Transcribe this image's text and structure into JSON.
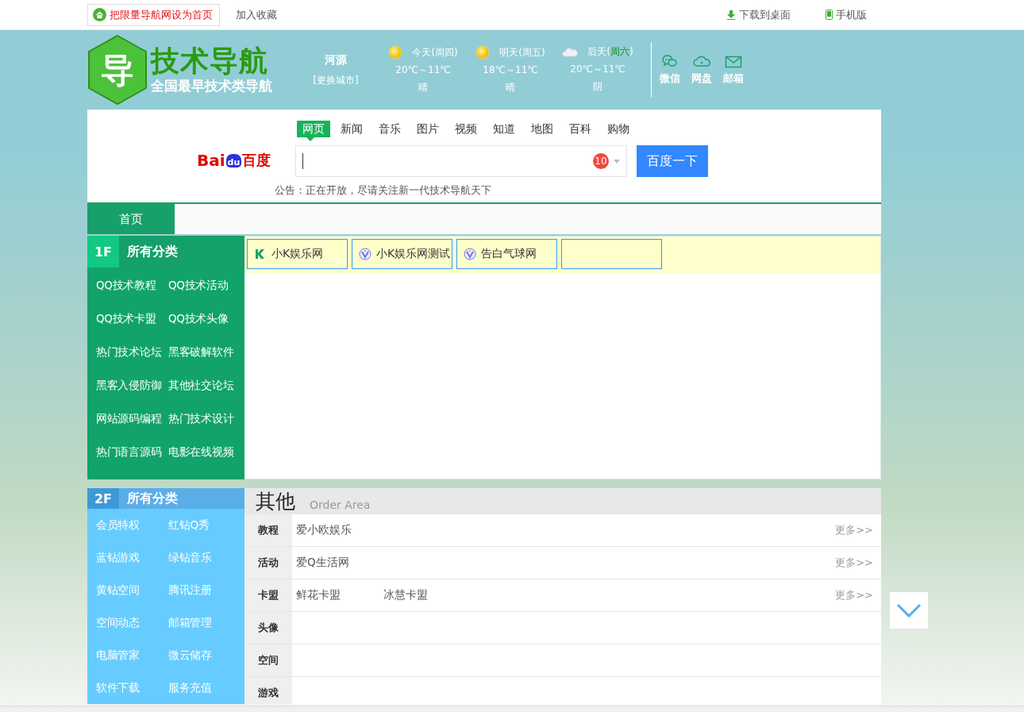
{
  "top_bar": {
    "set_homepage": "把限量导航网设为首页",
    "add_favorite": "加入收藏",
    "download": "下载到桌面",
    "mobile": "手机版"
  },
  "header": {
    "logo_glyph": "导",
    "logo_title": "技术导航",
    "logo_slogan": "全国最早技术类导航",
    "city": "河源",
    "change_city": "[更换城市]",
    "forecast": [
      {
        "kind": "sunny",
        "before": "今天(",
        "weekday": "周四",
        "after": ")",
        "weekday_highlight": false,
        "temperature": "20℃～11℃",
        "condition": "晴"
      },
      {
        "kind": "sunny",
        "before": "明天(",
        "weekday": "周五",
        "after": ")",
        "weekday_highlight": false,
        "temperature": "18℃～11℃",
        "condition": "晴"
      },
      {
        "kind": "cloudy",
        "before": "后天(",
        "weekday": "周六",
        "after": ")",
        "weekday_highlight": true,
        "temperature": "20℃～11℃",
        "condition": "阴"
      }
    ],
    "quick_links": [
      {
        "kind": "chat",
        "label": "微信"
      },
      {
        "kind": "cloud",
        "label": "网盘"
      },
      {
        "kind": "mail",
        "label": "邮箱"
      }
    ]
  },
  "search": {
    "logo_left": "Bai",
    "logo_paw": "du",
    "logo_right": "百度",
    "tabs": [
      {
        "label": "网页",
        "selected": true
      },
      {
        "label": "新闻",
        "selected": false
      },
      {
        "label": "音乐",
        "selected": false
      },
      {
        "label": "图片",
        "selected": false
      },
      {
        "label": "视频",
        "selected": false
      },
      {
        "label": "知道",
        "selected": false
      },
      {
        "label": "地图",
        "selected": false
      },
      {
        "label": "百科",
        "selected": false
      },
      {
        "label": "购物",
        "selected": false
      }
    ],
    "badge": "10",
    "button": "百度一下",
    "notice": "公告：正在开放，尽请关注新一代技术导航天下"
  },
  "nav": [
    {
      "label": "首页",
      "selected": true
    }
  ],
  "floor1": {
    "number": "1F",
    "title": "所有分类",
    "categories": [
      "QQ技术教程",
      "QQ技术活动",
      "QQ技术卡盟",
      "QQ技术头像",
      "热门技术论坛",
      "黑客破解软件",
      "黑客入侵防御",
      "其他社交论坛",
      "网站源码编程",
      "热门技术设计",
      "热门语言源码",
      "电影在线视频"
    ],
    "sites": [
      {
        "kind": "k",
        "label": "小K娱乐网"
      },
      {
        "kind": "v",
        "label": "小K娱乐网测试"
      },
      {
        "kind": "v",
        "label": "告白气球网"
      },
      {
        "kind": "empty"
      }
    ]
  },
  "floor2": {
    "number": "2F",
    "title": "所有分类",
    "categories": [
      "会员特权",
      "红钻Q秀",
      "蓝钻游戏",
      "绿钻音乐",
      "黄钻空间",
      "腾讯注册",
      "空间动态",
      "邮箱管理",
      "电脑管家",
      "微云储存",
      "软件下载",
      "服务充值"
    ],
    "heading": "其他",
    "subheading": "Order Area",
    "rows": [
      {
        "label": "教程",
        "links": [
          "爱小欧娱乐"
        ],
        "more": "更多>>"
      },
      {
        "label": "活动",
        "links": [
          "爱Q生活网"
        ],
        "more": "更多>>"
      },
      {
        "label": "卡盟",
        "links": [
          "鲜花卡盟",
          "冰慧卡盟"
        ],
        "more": "更多>>"
      },
      {
        "label": "头像",
        "links": []
      },
      {
        "label": "空间",
        "links": []
      },
      {
        "label": "游戏",
        "links": []
      }
    ]
  }
}
